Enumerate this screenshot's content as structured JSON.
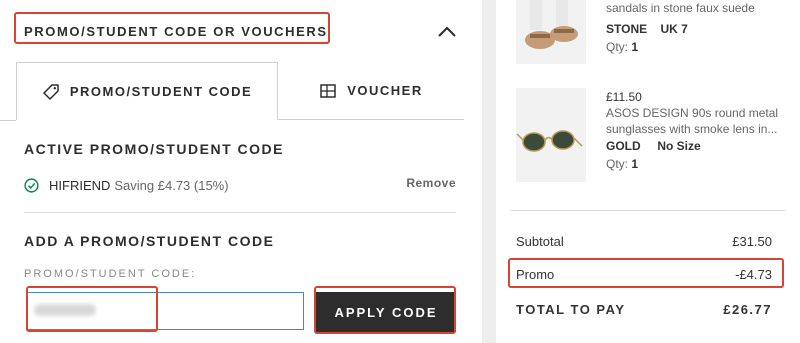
{
  "promo_section": {
    "title": "PROMO/STUDENT CODE OR VOUCHERS",
    "tabs": [
      {
        "label": "PROMO/STUDENT CODE",
        "icon": "tag-icon",
        "active": true
      },
      {
        "label": "VOUCHER",
        "icon": "voucher-icon",
        "active": false
      }
    ],
    "active_heading": "ACTIVE PROMO/STUDENT CODE",
    "active_code": "HIFRIEND",
    "active_saving": "Saving £4.73 (15%)",
    "remove_label": "Remove",
    "add_heading": "ADD A PROMO/STUDENT CODE",
    "field_label": "PROMO/STUDENT CODE:",
    "apply_label": "APPLY CODE"
  },
  "bag_items": [
    {
      "desc": "sandals in stone faux suede",
      "colour": "STONE",
      "size": "UK 7",
      "qty_label": "Qty:",
      "qty": "1"
    },
    {
      "price": "£11.50",
      "desc_line1": "ASOS DESIGN 90s round metal",
      "desc_line2": "sunglasses with smoke lens in...",
      "colour": "GOLD",
      "size": "No Size",
      "qty_label": "Qty:",
      "qty": "1"
    }
  ],
  "summary": {
    "subtotal_label": "Subtotal",
    "subtotal_value": "£31.50",
    "promo_label": "Promo",
    "promo_value": "-£4.73",
    "total_label": "TOTAL TO PAY",
    "total_value": "£26.77"
  },
  "colors": {
    "highlight": "#d9442f",
    "success": "#018849",
    "button": "#2d2d2d"
  }
}
